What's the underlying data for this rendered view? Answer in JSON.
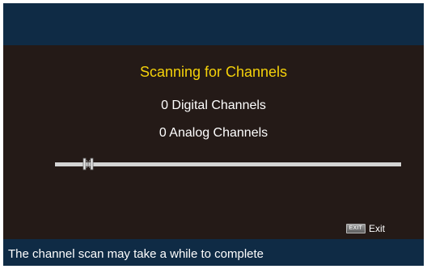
{
  "scan": {
    "title": "Scanning for Channels",
    "digital_channels": "0 Digital Channels",
    "analog_channels": "0 Analog Channels",
    "progress_icon": "scan-progress-handle"
  },
  "exit": {
    "key_label": "EXIT",
    "label": "Exit",
    "icon": "exit-key-icon"
  },
  "footer": {
    "message": "The channel scan may take a while to complete"
  },
  "colors": {
    "header_background": "#0f2b45",
    "panel_background": "#241a17",
    "title_text": "#f5d20a",
    "body_text": "#ffffff",
    "progress_track": "#d4d4d4"
  }
}
